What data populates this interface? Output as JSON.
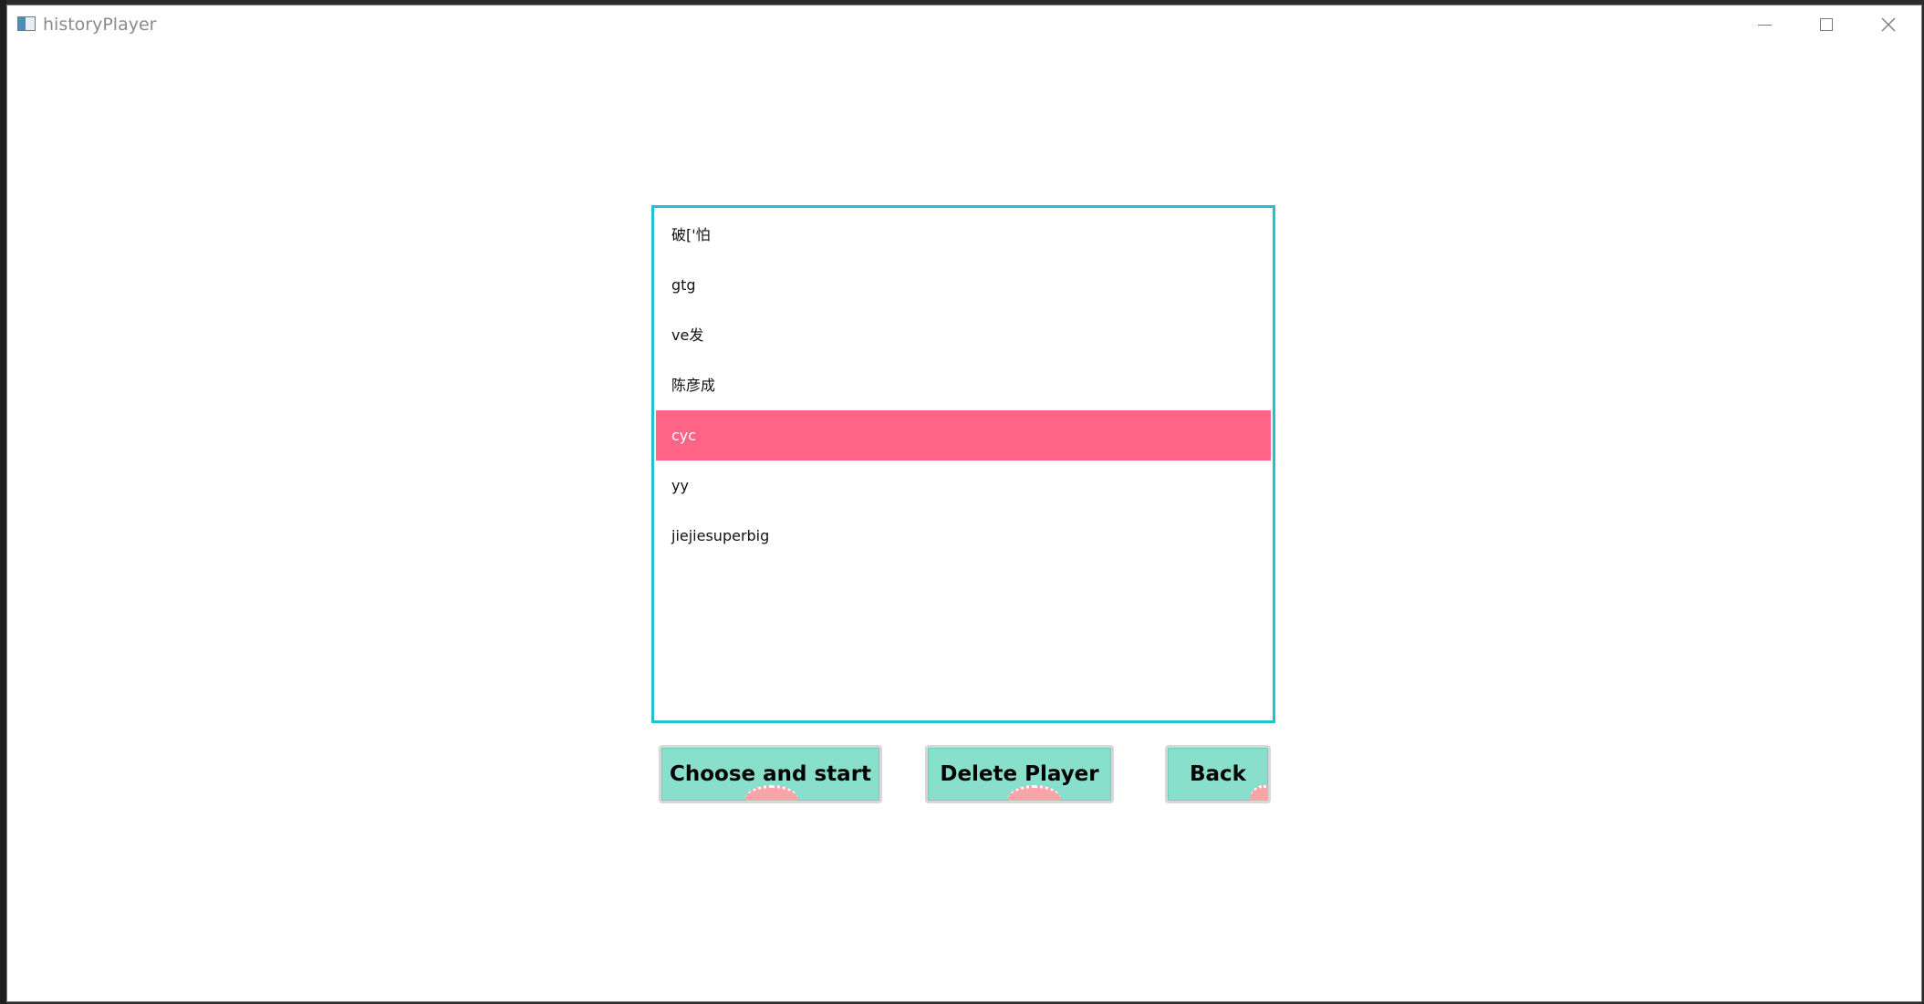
{
  "window": {
    "title": "historyPlayer"
  },
  "players": {
    "items": [
      {
        "label": "破['怕"
      },
      {
        "label": "gtg"
      },
      {
        "label": "ve发"
      },
      {
        "label": "陈彦成"
      },
      {
        "label": "cyc"
      },
      {
        "label": "yy"
      },
      {
        "label": "jiejiesuperbig"
      }
    ],
    "selected_label": "cyc"
  },
  "buttons": {
    "choose_label": "Choose and start",
    "delete_label": "Delete Player",
    "back_label": "Back"
  },
  "colors": {
    "list_border": "#20c2cf",
    "selection": "#ff6487",
    "button_fill": "#88dfcc"
  },
  "icons": {
    "app": "app-window-icon",
    "minimize": "minimize-icon",
    "maximize": "maximize-icon",
    "close": "close-icon"
  }
}
